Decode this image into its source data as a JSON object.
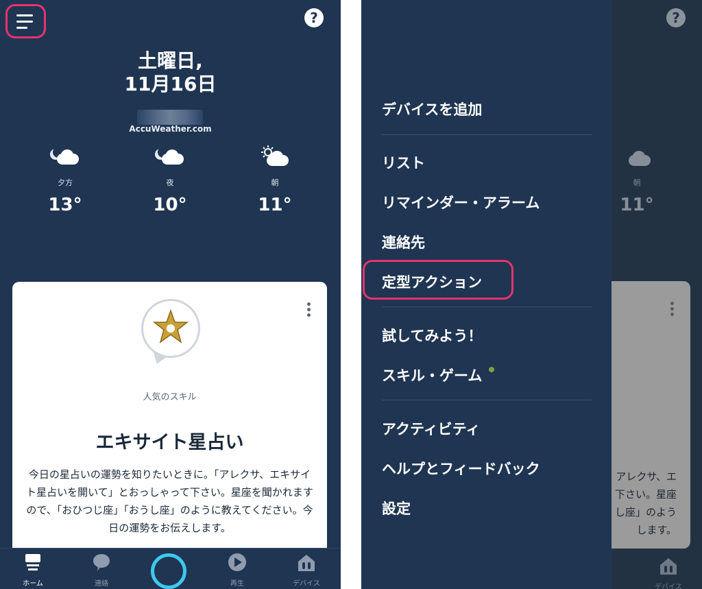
{
  "left": {
    "date_line1": "土曜日,",
    "date_line2": "11月16日",
    "weather_source": "AccuWeather.com",
    "forecast": [
      {
        "label": "夕方",
        "temp": "13°",
        "icon": "partly-cloudy-night-icon"
      },
      {
        "label": "夜",
        "temp": "10°",
        "icon": "partly-cloudy-night-icon"
      },
      {
        "label": "朝",
        "temp": "11°",
        "icon": "partly-cloudy-day-icon"
      }
    ],
    "card": {
      "category": "人気のスキル",
      "title": "エキサイト星占い",
      "description": "今日の星占いの運勢を知りたいときに。「アレクサ、エキサイト星占いを開いて」とおっしゃって下さい。星座を聞かれますので、「おひつじ座」「おうし座」のように教えてください。今日の運勢をお伝えします。"
    },
    "tabs": [
      {
        "label": "ホーム",
        "icon": "home-icon",
        "active": true
      },
      {
        "label": "連絡",
        "icon": "chat-bubble-icon",
        "active": false
      },
      {
        "label": "",
        "icon": "alexa-ring-icon",
        "active": false
      },
      {
        "label": "再生",
        "icon": "play-icon",
        "active": false
      },
      {
        "label": "デバイス",
        "icon": "devices-icon",
        "active": false
      }
    ]
  },
  "right": {
    "menu": [
      "デバイスを追加",
      "リスト",
      "リマインダー・アラーム",
      "連絡先",
      "定型アクション",
      "試してみよう！",
      "スキル・ゲーム",
      "アクティビティ",
      "ヘルプとフィードバック",
      "設定"
    ],
    "highlighted_item": "定型アクション",
    "background_peek": {
      "forecast_label": "朝",
      "forecast_temp": "11°",
      "desc_lines": [
        "アレクサ、エ",
        "下さい。星座",
        "し座」のよう",
        "します。"
      ],
      "tab_label": "デバイス"
    }
  },
  "colors": {
    "background": "#1f3552",
    "highlight": "#e8336f",
    "alexa_ring": "#3ec8ee",
    "badge_dot": "#7da13b"
  }
}
